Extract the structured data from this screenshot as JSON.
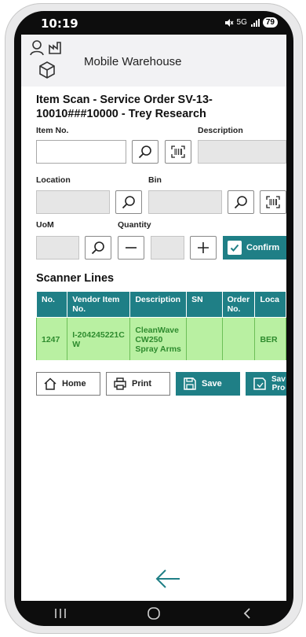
{
  "status_bar": {
    "time": "10:19",
    "network": "5G",
    "battery": "79"
  },
  "app": {
    "title": "Mobile Warehouse"
  },
  "page_heading": "Item Scan - Service Order SV-13-10010###10000 - Trey Research",
  "form": {
    "item_no_label": "Item No.",
    "item_no_value": "",
    "description_label": "Description",
    "location_label": "Location",
    "bin_label": "Bin",
    "uom_label": "UoM",
    "quantity_label": "Quantity",
    "confirm_label": "Confirm"
  },
  "scanner_lines": {
    "title": "Scanner Lines",
    "columns": [
      "No.",
      "Vendor Item No.",
      "Description",
      "SN",
      "Order No.",
      "Loca"
    ],
    "rows": [
      [
        "1247",
        "I-204245221CW",
        "CleanWave CW250 Spray Arms",
        "",
        "",
        "BER"
      ]
    ]
  },
  "actions": {
    "home_label": "Home",
    "print_label": "Print",
    "save_label": "Save",
    "save_proc_label": "Save Proc"
  },
  "colors": {
    "accent": "#1f7f86",
    "row_bg": "#b9f0a2",
    "row_text": "#2e8b2e"
  }
}
